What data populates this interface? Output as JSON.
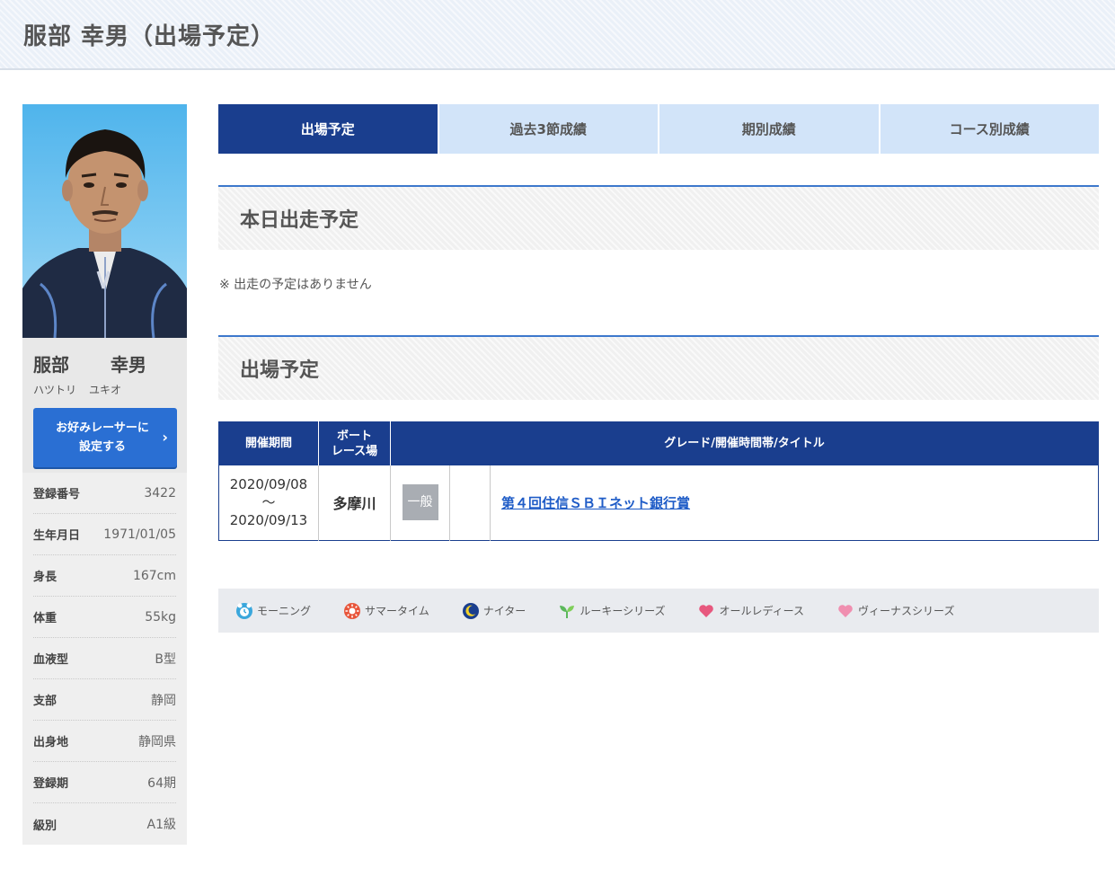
{
  "header": {
    "title": "服部 幸男（出場予定）"
  },
  "racer": {
    "name_family": "服部",
    "name_given": "幸男",
    "kana_family": "ハツトリ",
    "kana_given": "ユキオ",
    "favorite_button_line1": "お好みレーサーに",
    "favorite_button_line2": "設定する",
    "favorite_button_chevron": "›",
    "profile": [
      {
        "label": "登録番号",
        "value": "3422"
      },
      {
        "label": "生年月日",
        "value": "1971/01/05"
      },
      {
        "label": "身長",
        "value": "167cm"
      },
      {
        "label": "体重",
        "value": "55kg"
      },
      {
        "label": "血液型",
        "value": "B型"
      },
      {
        "label": "支部",
        "value": "静岡"
      },
      {
        "label": "出身地",
        "value": "静岡県"
      },
      {
        "label": "登録期",
        "value": "64期"
      },
      {
        "label": "級別",
        "value": "A1級"
      }
    ]
  },
  "tabs": [
    {
      "label": "出場予定",
      "active": true
    },
    {
      "label": "過去3節成績",
      "active": false
    },
    {
      "label": "期別成績",
      "active": false
    },
    {
      "label": "コース別成績",
      "active": false
    }
  ],
  "today": {
    "heading": "本日出走予定",
    "note": "※ 出走の予定はありません"
  },
  "schedule": {
    "heading": "出場予定",
    "columns": {
      "period": "開催期間",
      "venue_line1": "ボート",
      "venue_line2": "レース場",
      "grade": "グレード/開催時間帯/タイトル"
    },
    "rows": [
      {
        "start": "2020/09/08",
        "separator": "〜",
        "end": "2020/09/13",
        "venue": "多摩川",
        "grade": "一般",
        "time_slot": "",
        "title": "第４回住信ＳＢＩネット銀行賞"
      }
    ]
  },
  "legend": [
    {
      "label": "モーニング",
      "icon": "morning-icon",
      "color": "#3aa7dc"
    },
    {
      "label": "サマータイム",
      "icon": "summertime-icon",
      "color": "#e8553a"
    },
    {
      "label": "ナイター",
      "icon": "nighter-icon",
      "color": "#1a3e8e"
    },
    {
      "label": "ルーキーシリーズ",
      "icon": "rookie-icon",
      "color": "#5cb85c"
    },
    {
      "label": "オールレディース",
      "icon": "all-ladies-icon",
      "color": "#e7587e"
    },
    {
      "label": "ヴィーナスシリーズ",
      "icon": "venus-icon",
      "color": "#f08fb0"
    }
  ]
}
